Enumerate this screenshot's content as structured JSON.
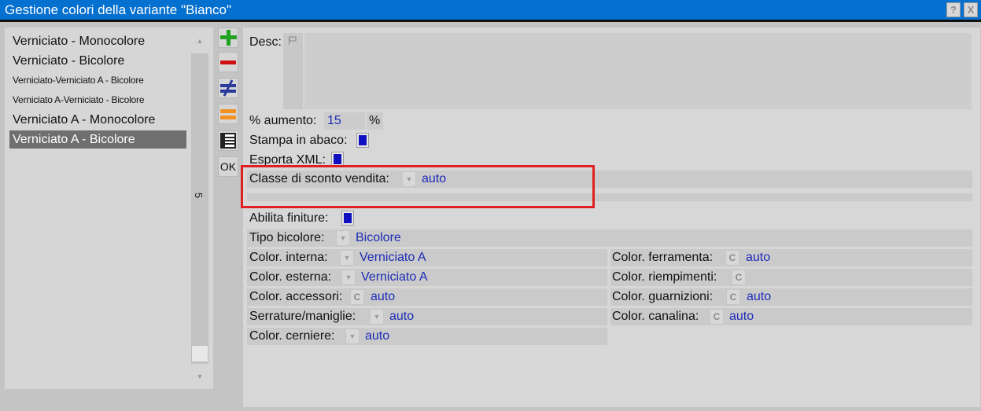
{
  "window": {
    "title": "Gestione colori della variante \"Bianco\"",
    "help_label": "?",
    "close_label": "X"
  },
  "list": {
    "items": [
      {
        "label": "Verniciato - Monocolore"
      },
      {
        "label": "Verniciato - Bicolore"
      },
      {
        "label": "Verniciato-Verniciato A - Bicolore"
      },
      {
        "label": "Verniciato A-Verniciato - Bicolore"
      },
      {
        "label": "Verniciato A - Monocolore"
      },
      {
        "label": "Verniciato A - Bicolore"
      }
    ],
    "selected_index": 5,
    "scroll_indicator": "5"
  },
  "toolbar": {
    "ok_label": "OK",
    "icons": [
      "add-icon",
      "remove-icon",
      "not-equal-icon",
      "equal-icon",
      "table-icon"
    ],
    "colors": {
      "add": "#1fa21f",
      "remove": "#d01010",
      "not_equal": "#2a3a9c",
      "equal": "#f39221"
    }
  },
  "form": {
    "desc_label": "Desc:",
    "percent": {
      "label": "% aumento:",
      "value": "15",
      "unit": "%"
    },
    "stampa": {
      "label": "Stampa in abaco:",
      "checked": true
    },
    "esporta": {
      "label": "Esporta XML:",
      "checked": true
    },
    "classe_sconto": {
      "label": "Classe di sconto vendita:",
      "value": "auto"
    },
    "abilita": {
      "label": "Abilita finiture:",
      "checked": true
    },
    "tipo_bicolore": {
      "label": "Tipo bicolore:",
      "value": "Bicolore"
    },
    "left": [
      {
        "label": "Color. interna:",
        "value": "Verniciato A"
      },
      {
        "label": "Color. esterna:",
        "value": "Verniciato A"
      },
      {
        "label": "Color. accessori:",
        "value": "auto"
      },
      {
        "label": "Serrature/maniglie:",
        "value": "auto"
      },
      {
        "label": "Color. cerniere:",
        "value": "auto"
      }
    ],
    "right": [
      {
        "label": "Color. ferramenta:",
        "value": "auto"
      },
      {
        "label": "Color. riempimenti:",
        "value": ""
      },
      {
        "label": "Color. guarnizioni:",
        "value": "auto"
      },
      {
        "label": "Color. canalina:",
        "value": "auto"
      }
    ],
    "c_button_label": "C"
  },
  "colors": {
    "titlebar": "#0470d0",
    "value_text": "#1c2bb5",
    "checkbox": "#1010c0",
    "highlight": "#e02020"
  }
}
